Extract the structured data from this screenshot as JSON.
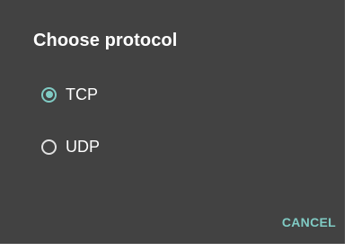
{
  "dialog": {
    "title": "Choose protocol",
    "options": [
      {
        "label": "TCP",
        "selected": true
      },
      {
        "label": "UDP",
        "selected": false
      }
    ],
    "cancel_label": "CANCEL"
  },
  "colors": {
    "background": "#424242",
    "accent": "#80cbc4",
    "text": "#ffffff"
  }
}
